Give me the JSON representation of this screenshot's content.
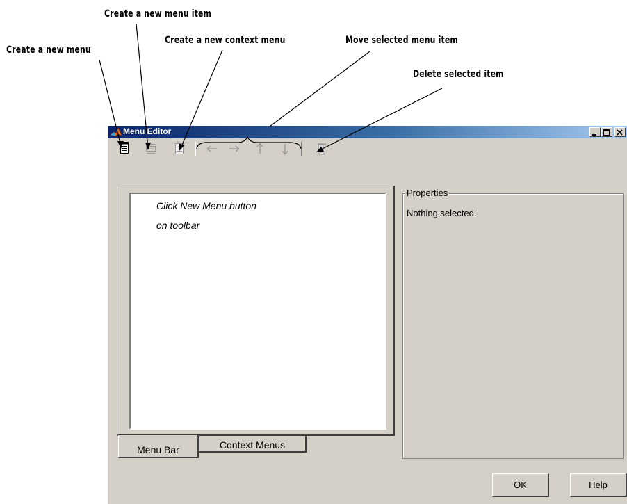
{
  "callouts": {
    "new_menu": "Create a new menu",
    "new_menu_item": "Create a new menu item",
    "new_context_menu": "Create a new context menu",
    "move_item": "Move selected menu item",
    "delete_item": "Delete selected item"
  },
  "window": {
    "title": "Menu Editor",
    "controls": {
      "minimize": "_",
      "maximize": "□",
      "close": "X"
    }
  },
  "toolbar": {
    "buttons": [
      {
        "icon": "new-menu-icon"
      },
      {
        "icon": "new-menu-item-icon"
      },
      {
        "icon": "new-context-menu-icon"
      },
      {
        "icon": "move-left-icon"
      },
      {
        "icon": "move-right-icon"
      },
      {
        "icon": "move-up-icon"
      },
      {
        "icon": "move-down-icon"
      },
      {
        "icon": "delete-icon"
      }
    ]
  },
  "menu_tree": {
    "hint_line1": "Click New Menu button",
    "hint_line2": "on toolbar"
  },
  "tabs": [
    {
      "label": "Menu Bar",
      "selected": true
    },
    {
      "label": "Context Menus",
      "selected": false
    }
  ],
  "properties": {
    "legend": "Properties",
    "status": "Nothing selected."
  },
  "buttons": {
    "ok": "OK",
    "help": "Help"
  },
  "colors": {
    "title_gradient_start": "#0a246a",
    "title_gradient_end": "#a6caf0",
    "window_face": "#d4d0c8"
  }
}
